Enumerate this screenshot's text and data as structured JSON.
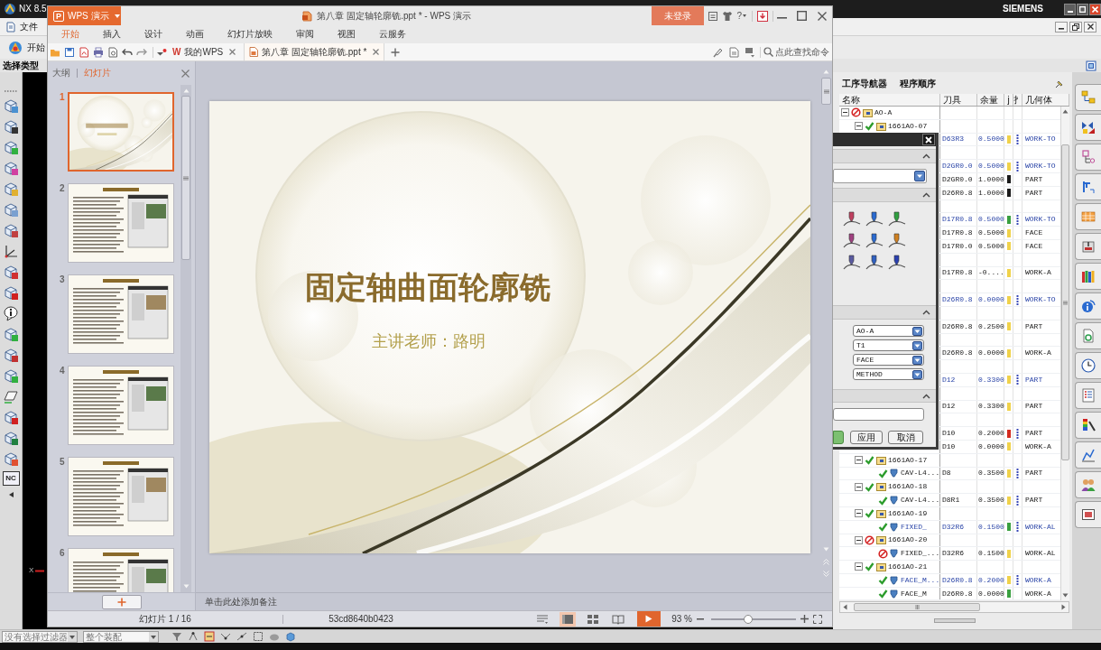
{
  "nx_window": {
    "title": "NX 8.5",
    "brand": "SIEMENS",
    "menu_label": "文件",
    "start_button": "开始",
    "selection_label": "选择类型",
    "toolbar_badge": "NC",
    "axis_label": "X"
  },
  "operation_navigator": {
    "title": "工序导航器",
    "view": "程序顺序",
    "columns": [
      "名称",
      "刀具",
      "余量",
      "j",
      "扌",
      "几何体"
    ],
    "tree": [
      {
        "kind": "program",
        "name": "AO-A",
        "blocked": true,
        "expanded": true,
        "children": [
          {
            "kind": "program",
            "name": "1661AO-07",
            "blocked": false,
            "expanded": true,
            "children": [
              {
                "tool": "D63R3",
                "stock": "0.5000",
                "color": "#f0d24a",
                "bar": true,
                "highlighted": true,
                "geometry": "WORK-TO"
              }
            ]
          },
          {
            "children": [
              {
                "tool": "D2GR0.0",
                "stock": "0.5000",
                "color": "#f0d24a",
                "bar": true,
                "highlighted": true,
                "geometry": "WORK-TO"
              },
              {
                "tool": "D2GR0.0",
                "stock": "1.0000",
                "color": "#1a1a1a",
                "bar": false,
                "highlighted": false,
                "geometry": "PART"
              },
              {
                "tool": "D26R0.8",
                "stock": "1.0000",
                "color": "#1a1a1a",
                "bar": false,
                "highlighted": false,
                "geometry": "PART"
              }
            ]
          },
          {
            "children": [
              {
                "tool": "D17R0.8",
                "stock": "0.5000",
                "color": "#3aa040",
                "bar": true,
                "highlighted": true,
                "geometry": "WORK-TO"
              },
              {
                "tool": "D17R0.8",
                "stock": "0.5000",
                "color": "#f0d24a",
                "bar": false,
                "highlighted": false,
                "geometry": "FACE"
              },
              {
                "tool": "D17R0.0",
                "stock": "0.5000",
                "color": "#f0d24a",
                "bar": false,
                "highlighted": false,
                "geometry": "FACE"
              }
            ]
          },
          {
            "children": [
              {
                "tool": "D17R0.8",
                "stock": "-0....",
                "color": "#f0d24a",
                "bar": false,
                "highlighted": false,
                "geometry": "WORK-A"
              }
            ]
          },
          {
            "children": [
              {
                "tool": "D26R0.8",
                "stock": "0.0000",
                "color": "#f0d24a",
                "bar": true,
                "highlighted": true,
                "geometry": "WORK-TO"
              }
            ]
          },
          {
            "children": [
              {
                "tool": "D26R0.8",
                "stock": "0.2500",
                "color": "#f0d24a",
                "bar": false,
                "highlighted": false,
                "geometry": "PART"
              }
            ]
          },
          {
            "children": [
              {
                "tool": "D26R0.8",
                "stock": "0.0000",
                "color": "#f0d24a",
                "bar": false,
                "highlighted": false,
                "geometry": "WORK-A"
              }
            ]
          },
          {
            "children": [
              {
                "tool": "D12",
                "stock": "0.3300",
                "color": "#f0d24a",
                "bar": true,
                "highlighted": true,
                "geometry": "PART"
              }
            ]
          },
          {
            "children": [
              {
                "tool": "D12",
                "stock": "0.3300",
                "color": "#f0d24a",
                "bar": false,
                "highlighted": false,
                "geometry": "PART"
              }
            ]
          },
          {
            "children": [
              {
                "tool": "D10",
                "stock": "0.2000",
                "color": "#d42a1e",
                "bar": true,
                "highlighted": false,
                "geometry": "PART"
              },
              {
                "tool": "D10",
                "stock": "0.0000",
                "color": "#f0d24a",
                "bar": false,
                "highlighted": false,
                "geometry": "WORK-A"
              }
            ]
          },
          {
            "kind": "program",
            "name": "1661AO-17",
            "blocked": false,
            "expanded": true,
            "children": [
              {
                "kind": "operation",
                "name": "CAV-L4...",
                "blocked": false,
                "tool": "D8",
                "stock": "0.3500",
                "color": "#f0d24a",
                "bar": true,
                "highlighted": false,
                "geometry": "PART"
              }
            ]
          },
          {
            "kind": "program",
            "name": "1661AO-18",
            "blocked": false,
            "expanded": true,
            "children": [
              {
                "kind": "operation",
                "name": "CAV-L4...",
                "blocked": false,
                "tool": "D8R1",
                "stock": "0.3500",
                "color": "#f0d24a",
                "bar": true,
                "highlighted": false,
                "geometry": "PART"
              }
            ]
          },
          {
            "kind": "program",
            "name": "1661AO-19",
            "blocked": false,
            "expanded": true,
            "children": [
              {
                "kind": "operation",
                "name": "FIXED_",
                "blocked": false,
                "tool": "D32R6",
                "stock": "0.1500",
                "color": "#3aa040",
                "bar": true,
                "highlighted": true,
                "geometry": "WORK-AL"
              }
            ]
          },
          {
            "kind": "program",
            "name": "1661AO-20",
            "blocked": true,
            "expanded": true,
            "children": [
              {
                "kind": "operation",
                "name": "FIXED_...",
                "blocked": true,
                "tool": "D32R6",
                "stock": "0.1500",
                "color": "#f0d24a",
                "bar": false,
                "highlighted": false,
                "geometry": "WORK-AL"
              }
            ]
          },
          {
            "kind": "program",
            "name": "1661AO-21",
            "blocked": false,
            "expanded": true,
            "children": [
              {
                "kind": "operation",
                "name": "FACE_M...",
                "blocked": false,
                "tool": "D26R0.8",
                "stock": "0.2000",
                "color": "#f0d24a",
                "bar": true,
                "highlighted": true,
                "geometry": "WORK-A"
              },
              {
                "kind": "operation",
                "name": "FACE_M",
                "blocked": false,
                "tool": "D26R0.8",
                "stock": "0.0000",
                "color": "#3aa040",
                "bar": false,
                "highlighted": false,
                "geometry": "WORK-A"
              }
            ]
          }
        ]
      }
    ]
  },
  "nx_dialog": {
    "fields": [
      "AO-A",
      "T1",
      "FACE",
      "METHOD"
    ],
    "buttons": [
      "应用",
      "取消"
    ]
  },
  "selection_bar": {
    "filters": [
      "没有选择过滤器",
      "整个装配"
    ]
  },
  "wps_window": {
    "app_logo": "P",
    "app_button": "WPS 演示",
    "title": "第八章 固定轴轮廓铣.ppt * - WPS 演示",
    "login_button": "未登录",
    "help_button": "?",
    "ribbon_tabs": [
      {
        "label": "开始",
        "selected": true
      },
      {
        "label": "插入",
        "selected": false
      },
      {
        "label": "设计",
        "selected": false
      },
      {
        "label": "动画",
        "selected": false
      },
      {
        "label": "幻灯片放映",
        "selected": false
      },
      {
        "label": "审阅",
        "selected": false
      },
      {
        "label": "视图",
        "selected": false
      },
      {
        "label": "云服务",
        "selected": false
      }
    ],
    "doc_tabs": [
      {
        "logo": "W",
        "label": "我的WPS",
        "selected": false
      },
      {
        "label": "第八章 固定轴轮廓铣.ppt *",
        "selected": true
      }
    ],
    "command_search": {
      "placeholder": "点此查找命令"
    },
    "panel_tabs": [
      {
        "label": "大纲",
        "selected": false
      },
      {
        "label": "幻灯片",
        "selected": true
      }
    ],
    "slides": [
      {
        "number": "1",
        "kind": "title",
        "selected": true
      },
      {
        "number": "2",
        "kind": "content",
        "selected": false
      },
      {
        "number": "3",
        "kind": "content",
        "selected": false
      },
      {
        "number": "4",
        "kind": "content",
        "selected": false
      },
      {
        "number": "5",
        "kind": "content",
        "selected": false
      },
      {
        "number": "6",
        "kind": "content",
        "selected": false
      }
    ],
    "slide": {
      "title": "固定轴曲面轮廓铣",
      "subtitle": "主讲老师：路明"
    },
    "notes": {
      "placeholder": "单击此处添加备注"
    },
    "status_bar": {
      "slide_counter": "幻灯片 1 / 16",
      "document_id": "53cd8640b0423",
      "views": [
        {
          "kind": "notes",
          "selected": false
        },
        {
          "kind": "normal",
          "selected": true
        },
        {
          "kind": "sorter",
          "selected": false
        },
        {
          "kind": "reading",
          "selected": false
        }
      ],
      "zoom": "93 %",
      "zoom_slider": {
        "level": 0.44
      }
    }
  }
}
